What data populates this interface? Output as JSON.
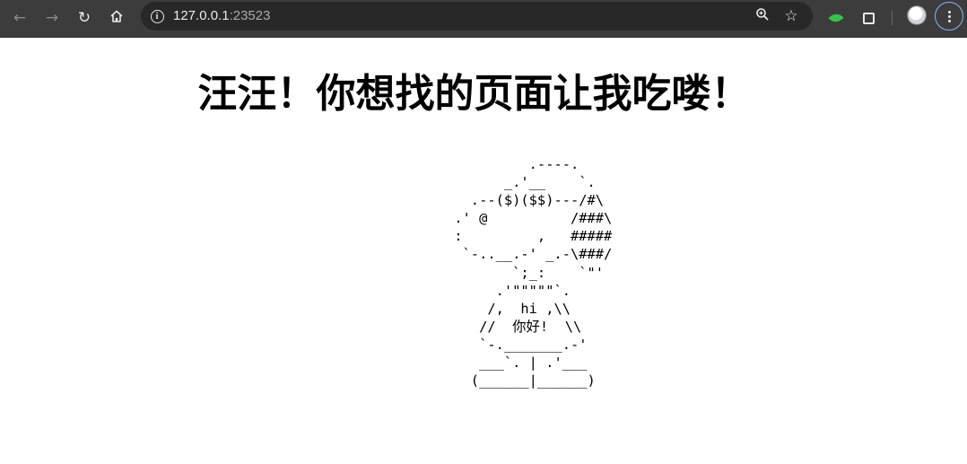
{
  "browser": {
    "url_host": "127.0.0.1",
    "url_port": ":23523",
    "icons": {
      "back": "arrow-left-icon",
      "forward": "arrow-right-icon",
      "reload": "reload-icon",
      "home": "home-icon",
      "site_info": "info-icon",
      "zoom": "zoom-icon",
      "bookmark": "star-icon",
      "extension": "leaf-extension-icon",
      "extensions_menu": "puzzle-icon",
      "profile": "avatar",
      "menu": "kebab-menu-icon"
    },
    "colors": {
      "toolbar_bg": "#3c3c3c",
      "omnibox_bg": "#282828",
      "text": "#e8eaed",
      "focus_ring": "#8ab4f8"
    }
  },
  "page": {
    "heading": "汪汪！你想找的页面让我吃喽！",
    "ascii_lines": [
      "          .----.",
      "       _.'__    `.",
      "   .--($)($$)---/#\\",
      " .' @          /###\\",
      " :         ,   #####",
      "  `-..__.-' _.-\\###/",
      "        `;_:    `\"'",
      "      .'\"\"\"\"\"`.",
      "     /,  hi ,\\\\",
      "    //  你好!  \\\\",
      "    `-._______.-'",
      "    ___`. | .'___",
      "   (______|______)"
    ]
  }
}
